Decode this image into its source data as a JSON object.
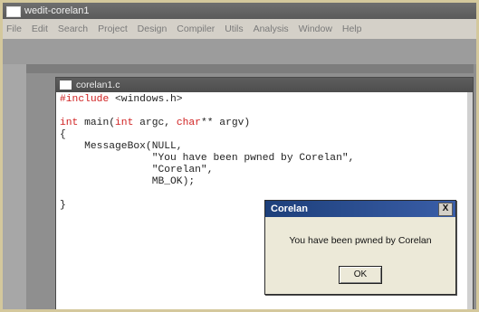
{
  "window": {
    "title": "wedit-corelan1"
  },
  "menu": [
    "File",
    "Edit",
    "Search",
    "Project",
    "Design",
    "Compiler",
    "Utils",
    "Analysis",
    "Window",
    "Help"
  ],
  "document": {
    "title": "corelan1.c",
    "code_lines": [
      {
        "parts": [
          {
            "t": "#include",
            "kw": true
          },
          {
            "t": " <windows.h>"
          }
        ]
      },
      {
        "parts": [
          {
            "t": ""
          }
        ]
      },
      {
        "parts": [
          {
            "t": "int",
            "kw": true
          },
          {
            "t": " main("
          },
          {
            "t": "int",
            "kw": true
          },
          {
            "t": " argc, "
          },
          {
            "t": "char",
            "kw": true
          },
          {
            "t": "** argv)"
          }
        ]
      },
      {
        "parts": [
          {
            "t": "{"
          }
        ]
      },
      {
        "parts": [
          {
            "t": "    MessageBox(NULL,"
          }
        ]
      },
      {
        "parts": [
          {
            "t": "               \"You have been pwned by Corelan\","
          }
        ]
      },
      {
        "parts": [
          {
            "t": "               \"Corelan\","
          }
        ]
      },
      {
        "parts": [
          {
            "t": "               MB_OK);"
          }
        ]
      },
      {
        "parts": [
          {
            "t": ""
          }
        ]
      },
      {
        "parts": [
          {
            "t": "}"
          }
        ]
      }
    ]
  },
  "dialog": {
    "title": "Corelan",
    "close_label": "X",
    "message": "You have been pwned by Corelan",
    "ok_label": "OK"
  }
}
